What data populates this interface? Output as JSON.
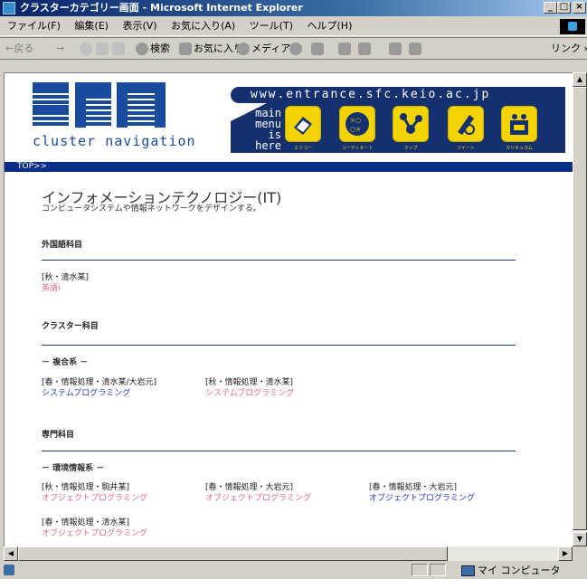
{
  "window": {
    "title": "クラスターカテゴリー画面 - Microsoft Internet Explorer",
    "min": "_",
    "max": "□",
    "close": "×"
  },
  "menubar": {
    "items": [
      "ファイル(F)",
      "編集(E)",
      "表示(V)",
      "お気に入り(A)",
      "ツール(T)",
      "ヘルプ(H)"
    ]
  },
  "toolbar": {
    "back": "←戻る",
    "forward": "→",
    "search": "検索",
    "favorites": "お気に入り",
    "media": "メディア",
    "links": "リンク »"
  },
  "header": {
    "logo_caption": "cluster navigation",
    "url_text": "www.entrance.sfc.keio.ac.jp",
    "main_menu": [
      "main",
      "menu",
      "is here"
    ],
    "nav": [
      {
        "label": "エリコー",
        "icon": "book-icon",
        "color": "#f4d400"
      },
      {
        "label": "コーディネート",
        "icon": "scatter-icon",
        "color": "#f4d400"
      },
      {
        "label": "マップ",
        "icon": "network-icon",
        "color": "#f4d400"
      },
      {
        "label": "ツイート",
        "icon": "writing-icon",
        "color": "#f4d400"
      },
      {
        "label": "カリキュラム",
        "icon": "robot-icon",
        "color": "#f4d400"
      }
    ],
    "breadcrumb": "TOP>>"
  },
  "page": {
    "title": "インフォメーションテクノロジー(IT)",
    "subtitle": "コンピュータシステムや情報ネットワークをデザインする。",
    "sections": {
      "foreign": {
        "heading": "外国語科目",
        "courses": [
          {
            "meta": "[秋・清水某]",
            "name": "英語I"
          }
        ]
      },
      "cluster": {
        "heading": "クラスター科目",
        "sub": "－ 複合系 －",
        "courses": [
          {
            "meta": "[春・情報処理・清水某/大岩元]",
            "name": "システムプログラミング"
          },
          {
            "meta": "[秋・情報処理・清水某]",
            "name": "システムプログラミング"
          }
        ]
      },
      "major": {
        "heading": "専門科目",
        "sub": "－ 環境情報系 －",
        "courses": [
          {
            "meta": "[秋・情報処理・駒井某]",
            "name": "オブジェクトプログラミング"
          },
          {
            "meta": "[春・情報処理・大岩元]",
            "name": "オブジェクトプログラミング"
          },
          {
            "meta": "[春・情報処理・大岩元]",
            "name": "オブジェクトプログラミング"
          },
          {
            "meta": "[春・情報処理・清水某]",
            "name": "オブジェクトプログラミング"
          }
        ]
      }
    }
  },
  "status": {
    "zone": "マイ コンピュータ"
  }
}
